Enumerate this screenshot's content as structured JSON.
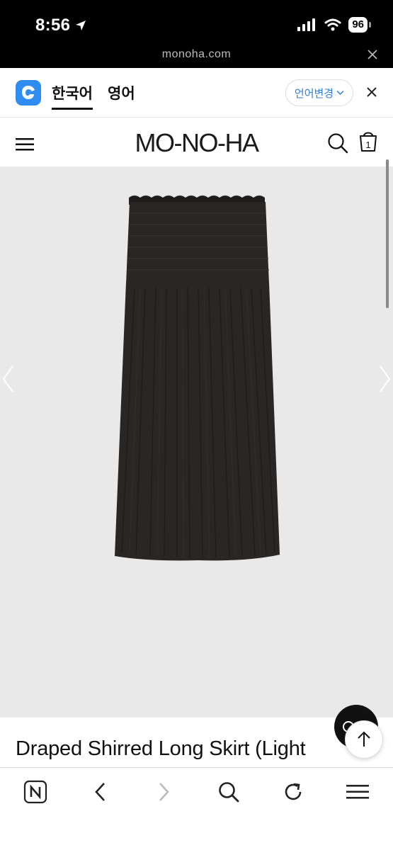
{
  "status_bar": {
    "time": "8:56",
    "battery": "96"
  },
  "browser": {
    "url": "monoha.com"
  },
  "translation_bar": {
    "source_lang": "한국어",
    "target_lang": "영어",
    "change_language": "언어변경"
  },
  "site": {
    "logo": "MO-NO-HA"
  },
  "cart": {
    "count": "1"
  },
  "product": {
    "title": "Draped Shirred Long Skirt (Light"
  },
  "icons": {
    "location": "location-arrow-icon",
    "signal": "cellular-signal-icon",
    "wifi": "wifi-icon",
    "translate": "papago-translate-icon",
    "menu": "hamburger-menu-icon",
    "search": "search-icon",
    "bag": "shopping-bag-icon",
    "chat": "chat-icon",
    "top": "arrow-up-icon",
    "naver": "naver-n-icon",
    "back": "chevron-left-icon",
    "forward": "chevron-right-icon",
    "reload": "reload-icon",
    "tabs": "menu-lines-icon"
  },
  "colors": {
    "accent_blue": "#2f7fe0",
    "gallery_bg": "#e9e9e9",
    "skirt": "#2a2624"
  }
}
